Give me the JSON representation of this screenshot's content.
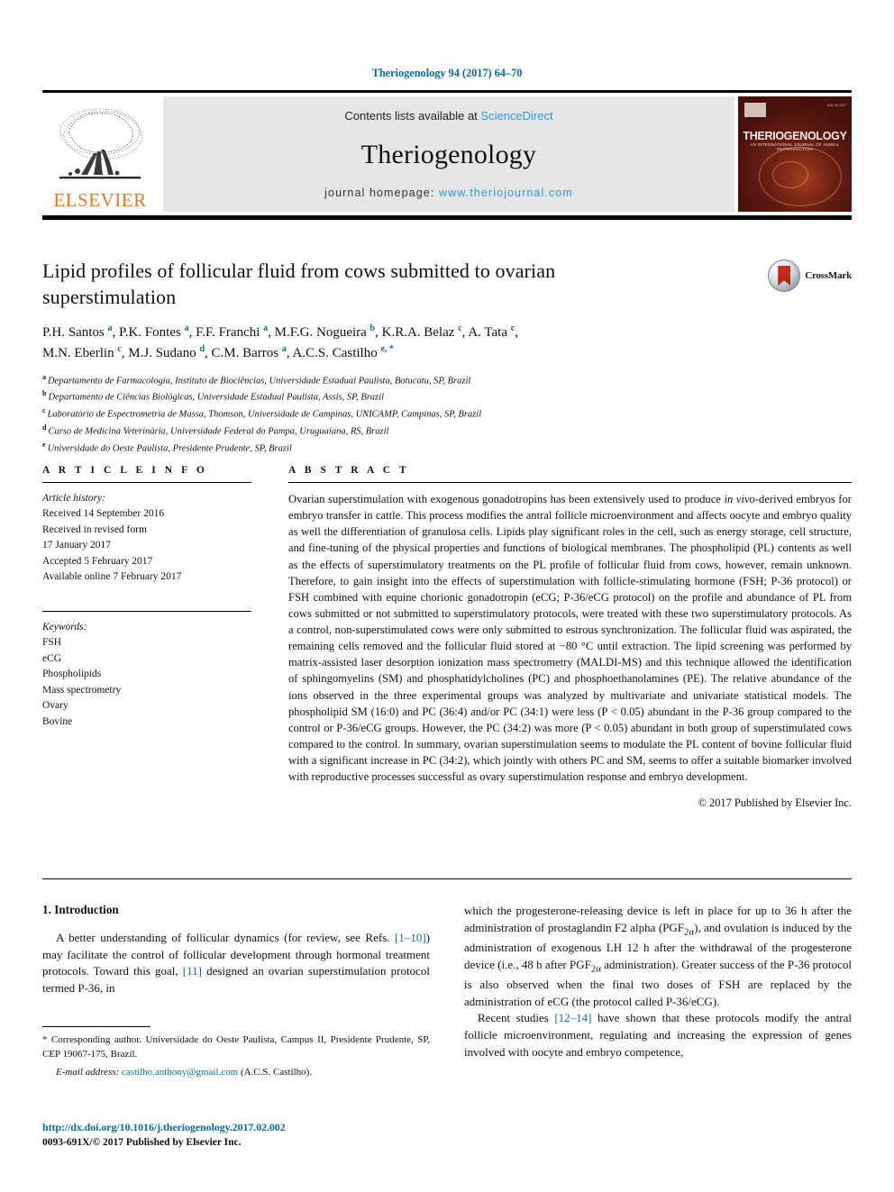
{
  "running_head": "Theriogenology 94 (2017) 64–70",
  "masthead": {
    "contents_prefix": "Contents lists available at ",
    "sciencedirect": "ScienceDirect",
    "journal_name": "Theriogenology",
    "homepage_prefix": "journal homepage: ",
    "homepage_url": "www.theriojournal.com",
    "elsevier_wordmark": "ELSEVIER",
    "cover_title": "THERIOGENOLOGY",
    "cover_subtitle": "AN INTERNATIONAL JOURNAL OF ANIMAL REPRODUCTION",
    "cover_corner": "VOL 94  2017"
  },
  "article": {
    "title": "Lipid profiles of follicular fluid from cows submitted to ovarian superstimulation",
    "crossmark_label": "CrossMark",
    "authors_line_1": "P.H. Santos <sup>a</sup>, P.K. Fontes <sup>a</sup>, F.F. Franchi <sup>a</sup>, M.F.G. Nogueira <sup>b</sup>, K.R.A. Belaz <sup>c</sup>, A. Tata <sup>c</sup>,",
    "authors_line_2": "M.N. Eberlin <sup>c</sup>, M.J. Sudano <sup>d</sup>, C.M. Barros <sup>a</sup>, A.C.S. Castilho <sup>e, *</sup>",
    "affiliations": [
      {
        "mark": "a",
        "text": "Departamento de Farmacologia, Instituto de Biociências, Universidade Estadual Paulista, Botucatu, SP, Brazil"
      },
      {
        "mark": "b",
        "text": "Departamento de Ciências Biológicas, Universidade Estadual Paulista, Assis, SP, Brazil"
      },
      {
        "mark": "c",
        "text": "Laboratório de Espectrometria de Massa, Thomson, Universidade de Campinas, UNICAMP, Campinas, SP, Brazil"
      },
      {
        "mark": "d",
        "text": "Curso de Medicina Veterinária, Universidade Federal do Pampa, Uruguaiana, RS, Brazil"
      },
      {
        "mark": "e",
        "text": "Universidade do Oeste Paulista, Presidente Prudente, SP, Brazil"
      }
    ]
  },
  "article_info": {
    "heading": "A R T I C L E  I N F O",
    "history_label": "Article history:",
    "history": [
      "Received 14 September 2016",
      "Received in revised form",
      "17 January 2017",
      "Accepted 5 February 2017",
      "Available online 7 February 2017"
    ],
    "keywords_label": "Keywords:",
    "keywords": [
      "FSH",
      "eCG",
      "Phospholipids",
      "Mass spectrometry",
      "Ovary",
      "Bovine"
    ]
  },
  "abstract": {
    "heading": "A B S T R A C T",
    "part_1": "Ovarian superstimulation with exogenous gonadotropins has been extensively used to produce ",
    "italic_1": "in vivo-",
    "part_2": "derived embryos for embryo transfer in cattle. This process modifies the antral follicle microenvironment and affects oocyte and embryo quality as well the differentiation of granulosa cells. Lipids play significant roles in the cell, such as energy storage, cell structure, and fine-tuning of the physical properties and functions of biological membranes. The phospholipid (PL) contents as well as the effects of superstimulatory treatments on the PL profile of follicular fluid from cows, however, remain unknown. Therefore, to gain insight into the effects of superstimulation with follicle-stimulating hormone (FSH; P-36 protocol) or FSH combined with equine chorionic gonadotropin (eCG; P-36/eCG protocol) on the profile and abundance of PL from cows submitted or not submitted to superstimulatory protocols, were treated with these two superstimulatory protocols. As a control, non-superstimulated cows were only submitted to estrous synchronization. The follicular fluid was aspirated, the remaining cells removed and the follicular fluid stored at −80 °C until extraction. The lipid screening was performed by matrix-assisted laser desorption ionization mass spectrometry (MALDI-MS) and this technique allowed the identification of sphingomyelins (SM) and phosphatidylcholines (PC) and phosphoethanolamines (PE). The relative abundance of the ions observed in the three experimental groups was analyzed by multivariate and univariate statistical models. The phospholipid SM (16:0) and PC (36:4) and/or PC (34:1) were less (P < 0.05) abundant in the P-36 group compared to the control or P-36/eCG groups. However, the PC (34:2) was more (P < 0.05) abundant in both group of superstimulated cows compared to the control. In summary, ovarian superstimulation seems to modulate the PL content of bovine follicular fluid with a significant increase in PC (34:2), which jointly with others PC and SM, seems to offer a suitable biomarker involved with reproductive processes successful as ovary superstimulation response and embryo development.",
    "copyright": "© 2017 Published by Elsevier Inc."
  },
  "introduction": {
    "heading": "1. Introduction",
    "left_para_1_a": "A better understanding of follicular dynamics (for review, see Refs. ",
    "left_ref_1": "[1–10]",
    "left_para_1_b": ") may facilitate the control of follicular development through hormonal treatment protocols. Toward this goal, ",
    "left_ref_2": "[11]",
    "left_para_1_c": " designed an ovarian superstimulation protocol termed P-36, in",
    "right_para_1_a": "which the progesterone-releasing device is left in place for up to 36 h after the administration of prostaglandin F2 alpha (PGF",
    "right_sub_1": "2α",
    "right_para_1_b": "), and ovulation is induced by the administration of exogenous LH 12 h after the withdrawal of the progesterone device (i.e., 48 h after PGF",
    "right_sub_2": "2α",
    "right_para_1_c": " administration). Greater success of the P-36 protocol is also observed when the final two doses of FSH are replaced by the administration of eCG (the protocol called P-36/eCG).",
    "right_para_2_a": "Recent studies ",
    "right_ref_1": "[12–14]",
    "right_para_2_b": " have shown that these protocols modify the antral follicle microenvironment, regulating and increasing the expression of genes involved with oocyte and embryo competence,"
  },
  "footnote": {
    "star": "*",
    "text": " Corresponding author. Universidade do Oeste Paulista, Campus II, Presidente Prudente, SP, CEP 19067-175, Brazil.",
    "email_label": "E-mail address:",
    "email": "castilho.anthony@gmail.com",
    "email_owner": "(A.C.S. Castilho)."
  },
  "doi": {
    "link": "http://dx.doi.org/10.1016/j.theriogenology.2017.02.002",
    "issn": "0093-691X/© 2017 Published by Elsevier Inc."
  },
  "colors": {
    "link": "#0b6ba0",
    "sciencedirect": "#2e9bd6",
    "elsevier_orange": "#E87722"
  }
}
